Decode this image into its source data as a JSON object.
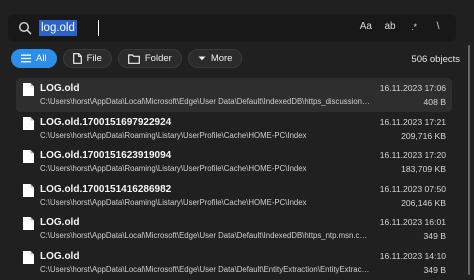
{
  "search": {
    "query": "log.old",
    "options": [
      "Aa",
      "ab",
      ".*",
      "\\"
    ]
  },
  "filters": [
    {
      "label": "All",
      "icon": "all-icon",
      "active": true
    },
    {
      "label": "File",
      "icon": "file-icon",
      "active": false
    },
    {
      "label": "Folder",
      "icon": "folder-icon",
      "active": false
    },
    {
      "label": "More",
      "icon": "chevron-down-icon",
      "active": false
    }
  ],
  "object_count": "506 objects",
  "results": [
    {
      "name": "LOG.old",
      "path": "C:\\Users\\horst\\AppData\\Local\\Microsoft\\Edge\\User Data\\Default\\IndexedDB\\https_discussion.l...",
      "date": "16.11.2023 17:06",
      "size": "408 B"
    },
    {
      "name": "LOG.old.1700151697922924",
      "path": "C:\\Users\\horst\\AppData\\Roaming\\Listary\\UserProfile\\Cache\\HOME-PC\\Index",
      "date": "16.11.2023 17:21",
      "size": "209,716 KB"
    },
    {
      "name": "LOG.old.1700151623919094",
      "path": "C:\\Users\\horst\\AppData\\Roaming\\Listary\\UserProfile\\Cache\\HOME-PC\\Index",
      "date": "16.11.2023 17:20",
      "size": "183,709 KB"
    },
    {
      "name": "LOG.old.1700151416286982",
      "path": "C:\\Users\\horst\\AppData\\Roaming\\Listary\\UserProfile\\Cache\\HOME-PC\\Index",
      "date": "16.11.2023 07:50",
      "size": "206,146 KB"
    },
    {
      "name": "LOG.old",
      "path": "C:\\Users\\horst\\AppData\\Local\\Microsoft\\Edge\\User Data\\Default\\IndexedDB\\https_ntp.msn.co...",
      "date": "16.11.2023 16:01",
      "size": "349 B"
    },
    {
      "name": "LOG.old",
      "path": "C:\\Users\\horst\\AppData\\Local\\Microsoft\\Edge\\User Data\\Default\\EntityExtraction\\EntityExtract...",
      "date": "16.11.2023 14:10",
      "size": "349 B"
    }
  ]
}
